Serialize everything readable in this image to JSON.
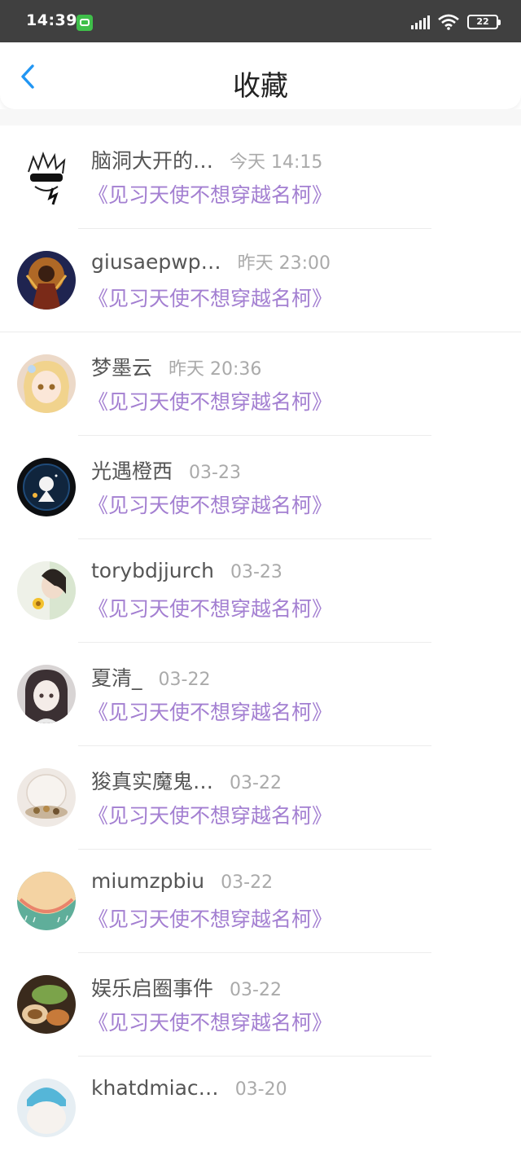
{
  "status_bar": {
    "time": "14:39",
    "battery": "22"
  },
  "header": {
    "title": "收藏"
  },
  "items": [
    {
      "name": "脑洞大开的…",
      "time": "今天 14:15",
      "book": "《见习天使不想穿越名柯》"
    },
    {
      "name": "giusaepwp…",
      "time": "昨天 23:00",
      "book": "《见习天使不想穿越名柯》"
    },
    {
      "name": "梦墨云",
      "time": "昨天 20:36",
      "book": "《见习天使不想穿越名柯》"
    },
    {
      "name": "光遇橙西",
      "time": "03-23",
      "book": "《见习天使不想穿越名柯》"
    },
    {
      "name": "torybdjjurch",
      "time": "03-23",
      "book": "《见习天使不想穿越名柯》"
    },
    {
      "name": "夏清_",
      "time": "03-22",
      "book": "《见习天使不想穿越名柯》"
    },
    {
      "name": "狻真实魔鬼…",
      "time": "03-22",
      "book": "《见习天使不想穿越名柯》"
    },
    {
      "name": "miumzpbiu",
      "time": "03-22",
      "book": "《见习天使不想穿越名柯》"
    },
    {
      "name": "娱乐启圈事件",
      "time": "03-22",
      "book": "《见习天使不想穿越名柯》"
    },
    {
      "name": "khatdmiac…",
      "time": "03-20",
      "book": ""
    }
  ],
  "colors": {
    "accent": "#2196f3",
    "book_title": "#a37fd1",
    "status_bar": "#404040"
  },
  "icons": [
    "back-arrow-icon",
    "signal-icon",
    "wifi-icon",
    "battery-icon",
    "app-notification-icon"
  ]
}
